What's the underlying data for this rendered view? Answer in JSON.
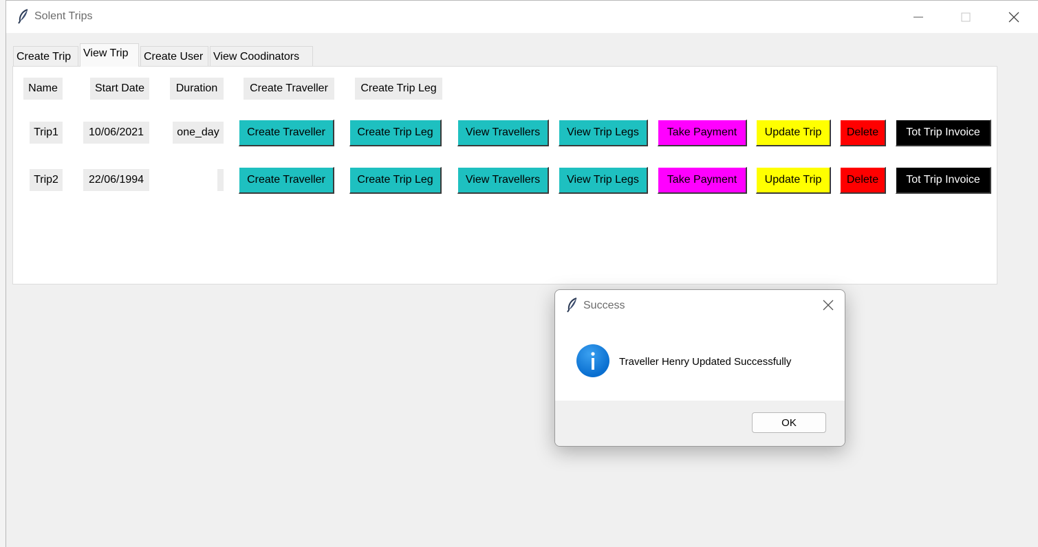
{
  "window": {
    "title": "Solent Trips"
  },
  "tabs": [
    "Create Trip",
    "View Trip",
    "Create User",
    "View Coodinators"
  ],
  "table": {
    "headers": [
      "Name",
      "Start Date",
      "Duration",
      "Create Traveller",
      "Create Trip Leg"
    ],
    "rows": [
      {
        "name": "Trip1",
        "start_date": "10/06/2021",
        "duration": "one_day"
      },
      {
        "name": "Trip2",
        "start_date": "22/06/1994",
        "duration": ""
      }
    ],
    "row_buttons": {
      "create_traveller": "Create Traveller",
      "create_trip_leg": "Create Trip Leg",
      "view_travellers": "View Travellers",
      "view_trip_legs": "View Trip Legs",
      "take_payment": "Take Payment",
      "update_trip": "Update Trip",
      "delete": "Delete",
      "tot_trip_invoice": "Tot Trip Invoice"
    }
  },
  "dialog": {
    "title": "Success",
    "message": "Traveller Henry Updated Successfully",
    "ok_label": "OK",
    "icon": "info-icon"
  },
  "colors": {
    "teal": "#1ec0c0",
    "magenta": "#ff00ff",
    "yellow": "#ffff00",
    "red": "#ff0000",
    "black": "#000000"
  }
}
